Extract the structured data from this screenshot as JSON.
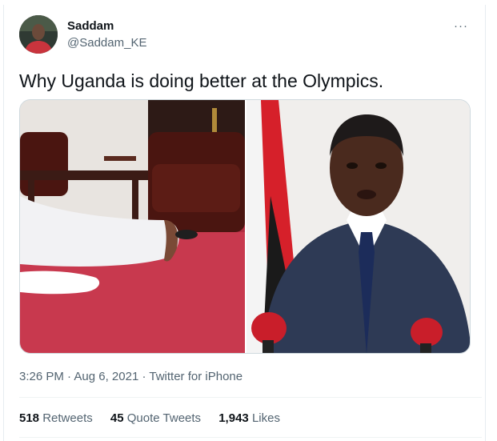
{
  "user": {
    "name": "Saddam",
    "handle": "@Saddam_KE"
  },
  "header": {
    "more_label": "···"
  },
  "tweet": {
    "text": "Why Uganda is doing better at the Olympics.",
    "time": "3:26 PM",
    "date": "Aug 6, 2021",
    "source": "Twitter for iPhone"
  },
  "media": [
    {
      "icon": "photo-man-lying-on-carpet"
    },
    {
      "icon": "photo-man-speaking-at-podium"
    }
  ],
  "stats": {
    "retweets_count": "518",
    "retweets_label": "Retweets",
    "quotes_count": "45",
    "quotes_label": "Quote Tweets",
    "likes_count": "1,943",
    "likes_label": "Likes"
  },
  "colors": {
    "text_primary": "#0f1419",
    "text_secondary": "#536471",
    "border": "#cfd9de"
  }
}
